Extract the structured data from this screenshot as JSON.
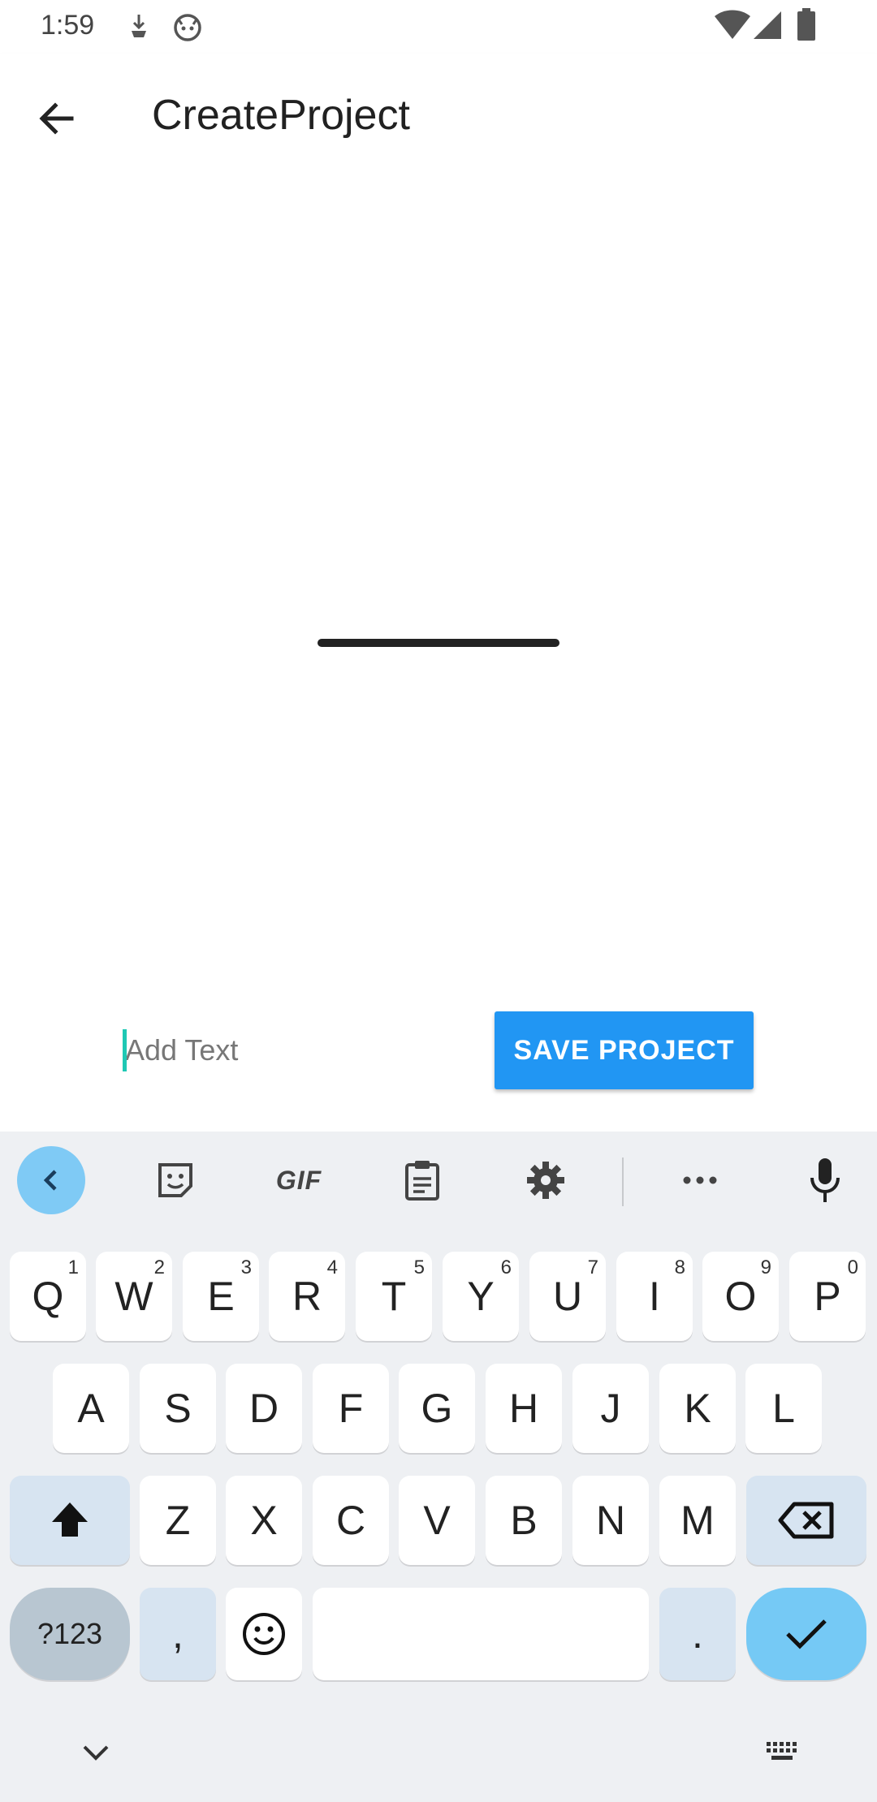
{
  "status_bar": {
    "time": "1:59"
  },
  "app_bar": {
    "title": "CreateProject"
  },
  "editor": {
    "input_value": "",
    "input_placeholder": "Add Text",
    "save_button_label": "SAVE PROJECT"
  },
  "colors": {
    "accent": "#2196f3",
    "caret": "#1ec8b4",
    "keyboard_bg": "#eef0f3",
    "enter_key": "#75c9f5"
  },
  "keyboard": {
    "toolbar": {
      "gif_label": "GIF"
    },
    "row1": [
      {
        "label": "Q",
        "alt": "1"
      },
      {
        "label": "W",
        "alt": "2"
      },
      {
        "label": "E",
        "alt": "3"
      },
      {
        "label": "R",
        "alt": "4"
      },
      {
        "label": "T",
        "alt": "5"
      },
      {
        "label": "Y",
        "alt": "6"
      },
      {
        "label": "U",
        "alt": "7"
      },
      {
        "label": "I",
        "alt": "8"
      },
      {
        "label": "O",
        "alt": "9"
      },
      {
        "label": "P",
        "alt": "0"
      }
    ],
    "row2": [
      "A",
      "S",
      "D",
      "F",
      "G",
      "H",
      "J",
      "K",
      "L"
    ],
    "row3": [
      "Z",
      "X",
      "C",
      "V",
      "B",
      "N",
      "M"
    ],
    "bottom": {
      "numbers_label": "?123",
      "comma_label": ",",
      "period_label": "."
    }
  }
}
